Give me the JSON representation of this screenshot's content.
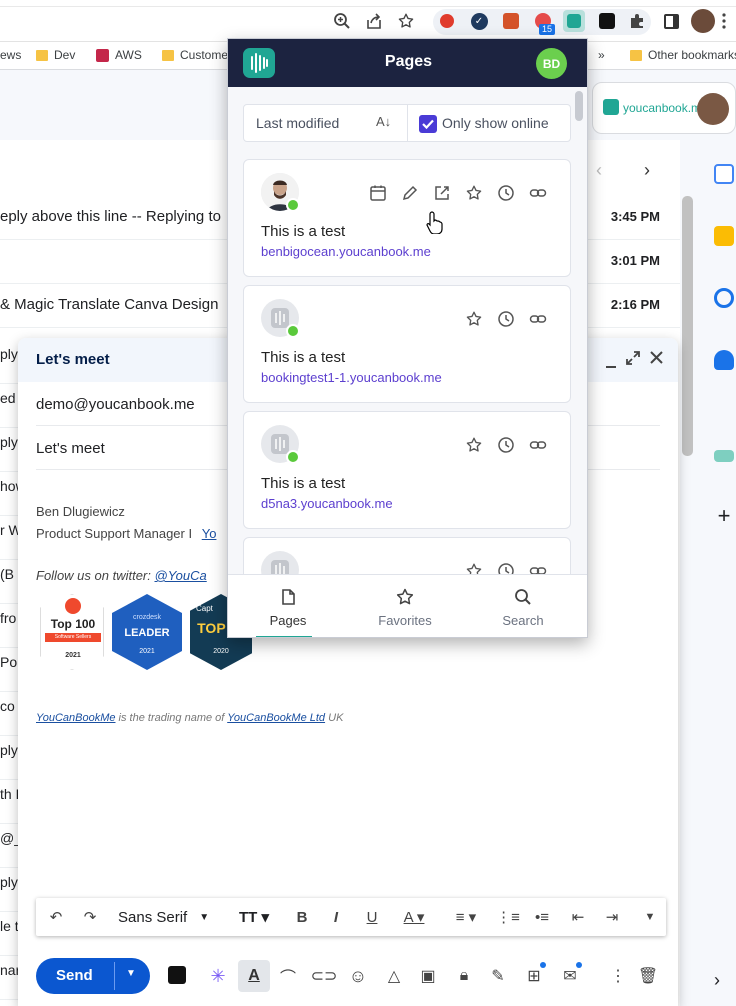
{
  "browser": {
    "bookmarks": [
      {
        "label": "ews",
        "type": "text"
      },
      {
        "label": "Dev",
        "type": "folder"
      },
      {
        "label": "AWS",
        "type": "link"
      },
      {
        "label": "Custome",
        "type": "folder"
      },
      {
        "label": "Other bookmarks",
        "type": "folder"
      }
    ],
    "overflow": "»",
    "extension_badge": "15"
  },
  "gmail": {
    "rows": [
      {
        "text": "eply above this line -- Replying to",
        "time": "3:45 PM"
      },
      {
        "text": "",
        "time": "3:01 PM"
      },
      {
        "text": " & Magic Translate Canva Design",
        "time": "2:16 PM"
      }
    ],
    "left_snippets": [
      "ply",
      "ed",
      "ply",
      "how",
      "r W",
      "(B",
      "fro",
      "Po",
      "co",
      "ply",
      "th H",
      "@_",
      "ply",
      "le t",
      "nar"
    ],
    "ycbm_badge": "youcanbook.me",
    "rail_plus": "+"
  },
  "compose": {
    "title": "Let's meet",
    "to": "demo@youcanbook.me",
    "subject": "Let's meet",
    "signature_name": "Ben Dlugiewicz",
    "signature_role": "Product Support Manager I",
    "signature_link": "Yo",
    "twitter_prefix": "Follow us on twitter: ",
    "twitter_link": "@YouCa",
    "footer_link1": "YouCanBookMe",
    "footer_mid": " is the trading name of ",
    "footer_link2": "YouCanBookMe Ltd",
    "footer_suffix": " UK",
    "badges": [
      {
        "line1": "Top 100",
        "line2": "Software Sellers",
        "line3": "2021"
      },
      {
        "line1": "crozdesk",
        "line2": "LEADER",
        "line3": "2021"
      },
      {
        "line1": "Capt",
        "line2": "TOP 20",
        "line3": "2020"
      }
    ],
    "font": "Sans Serif",
    "send": "Send"
  },
  "popup": {
    "title": "Pages",
    "avatar_initials": "BD",
    "sort_label": "Last modified",
    "online_label": "Only show online",
    "online_checked": true,
    "cards": [
      {
        "title": "This is a test",
        "url": "benbigocean.youcanbook.me",
        "photo": true,
        "extra_actions": true
      },
      {
        "title": "This is a test",
        "url": "bookingtest1-1.youcanbook.me",
        "photo": false,
        "extra_actions": false
      },
      {
        "title": "This is a test",
        "url": "d5na3.youcanbook.me",
        "photo": false,
        "extra_actions": false
      },
      {
        "title": "",
        "url": "",
        "photo": false,
        "extra_actions": false
      }
    ],
    "tabs": [
      {
        "label": "Pages",
        "icon": "page-icon",
        "active": true
      },
      {
        "label": "Favorites",
        "icon": "star-icon",
        "active": false
      },
      {
        "label": "Search",
        "icon": "search-icon",
        "active": false
      }
    ]
  },
  "colors": {
    "popup_header": "#1c2340",
    "accent_teal": "#20a694",
    "link_purple": "#5c3fcf",
    "online_green": "#5ac93b",
    "gmail_blue": "#0b57d0"
  }
}
